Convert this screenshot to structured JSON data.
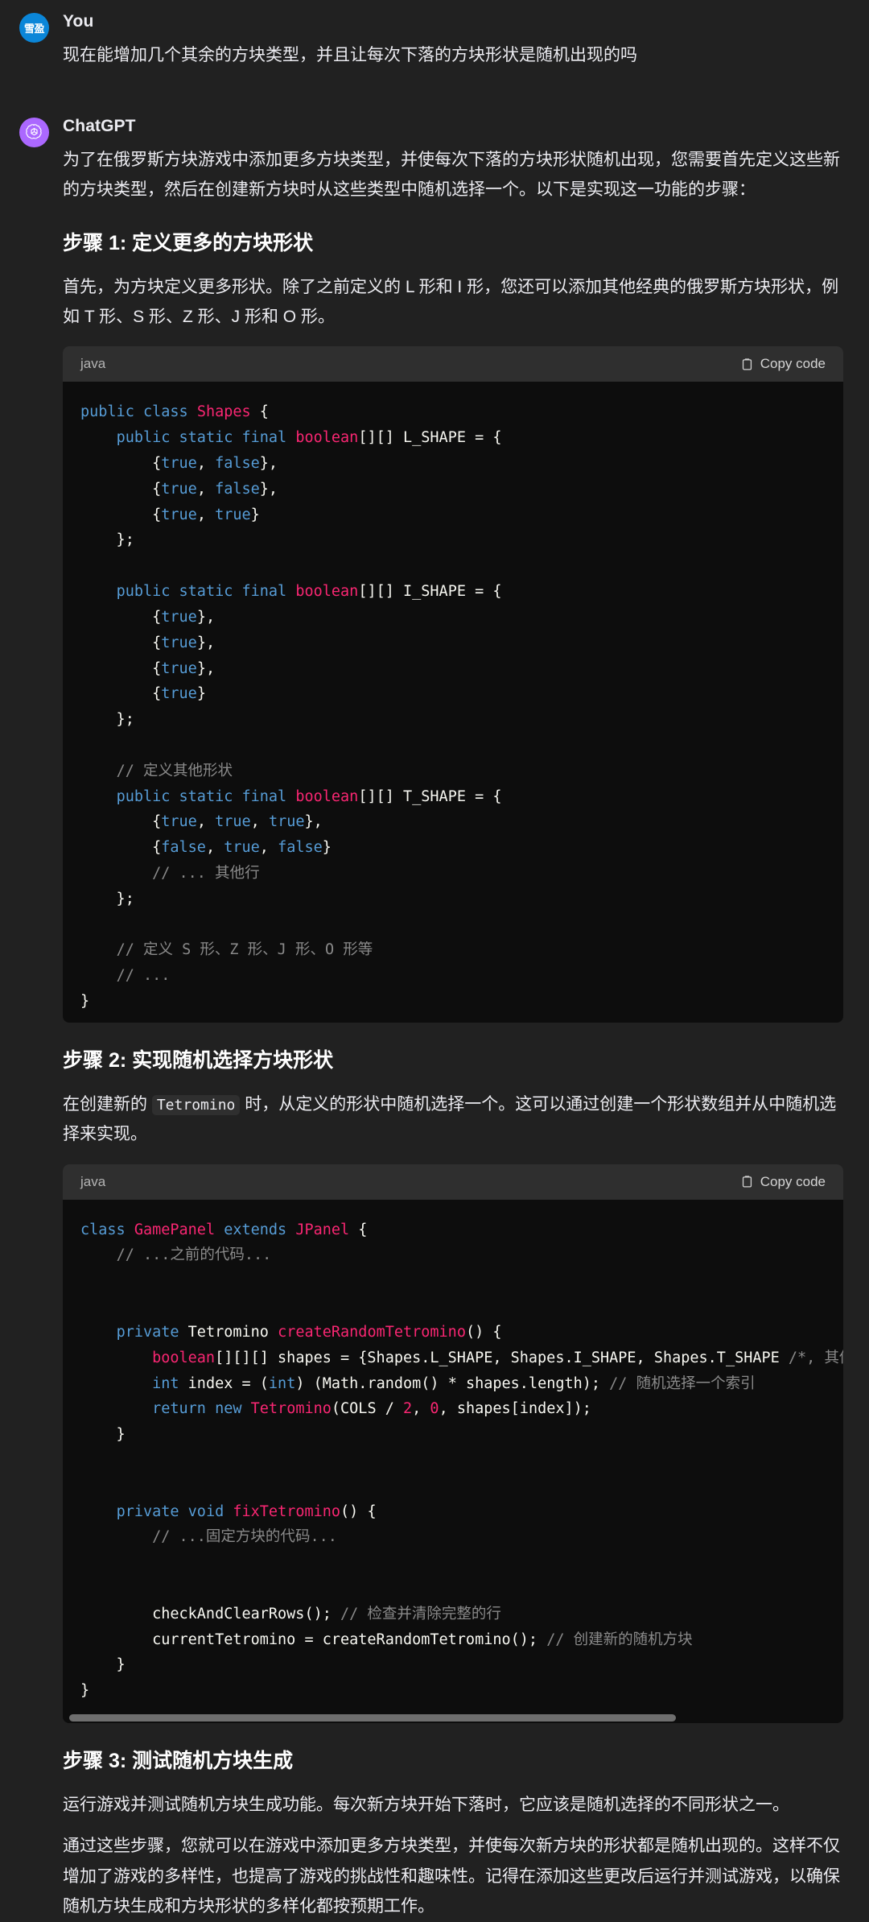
{
  "theme": {
    "page_bg": "#212121",
    "code_bg": "#0d0d0d",
    "code_header_bg": "#2f2f2f",
    "user_avatar_bg": "#0b86d8",
    "assistant_avatar_bg": "#ab68ff",
    "text": "#ececf1",
    "comment": "#8a8a8a",
    "keyword": "#569cd6",
    "type": "#f92672",
    "number": "#f92672"
  },
  "messages": [
    {
      "role": "user",
      "author": "You",
      "avatar_text": "雪盈",
      "avatar_icon": "user-avatar-icon",
      "text": "现在能增加几个其余的方块类型，并且让每次下落的方块形状是随机出现的吗"
    },
    {
      "role": "assistant",
      "author": "ChatGPT",
      "avatar_icon": "openai-logo-icon",
      "intro": "为了在俄罗斯方块游戏中添加更多方块类型，并使每次下落的方块形状随机出现，您需要首先定义这些新的方块类型，然后在创建新方块时从这些类型中随机选择一个。以下是实现这一功能的步骤：",
      "steps": [
        {
          "heading": "步骤 1: 定义更多的方块形状",
          "paragraph": "首先，为方块定义更多形状。除了之前定义的 L 形和 I 形，您还可以添加其他经典的俄罗斯方块形状，例如 T 形、S 形、Z 形、J 形和 O 形。",
          "code": {
            "language": "java",
            "copy_label": "Copy code",
            "copy_icon": "clipboard-icon"
          }
        },
        {
          "heading": "步骤 2: 实现随机选择方块形状",
          "paragraph_pre": "在创建新的 ",
          "paragraph_code": "Tetromino",
          "paragraph_post": " 时，从定义的形状中随机选择一个。这可以通过创建一个形状数组并从中随机选择来实现。",
          "code": {
            "language": "java",
            "copy_label": "Copy code",
            "copy_icon": "clipboard-icon"
          }
        },
        {
          "heading": "步骤 3: 测试随机方块生成",
          "paragraph": "运行游戏并测试随机方块生成功能。每次新方块开始下落时，它应该是随机选择的不同形状之一。"
        }
      ],
      "conclusion": "通过这些步骤，您就可以在游戏中添加更多方块类型，并使每次新方块的形状都是随机出现的。这样不仅增加了游戏的多样性，也提高了游戏的挑战性和趣味性。记得在添加这些更改后运行并测试游戏，以确保随机方块生成和方块形状的多样化都按预期工作。"
    }
  ],
  "code_blocks": [
    {
      "id": "shapes-java",
      "language": "java",
      "lines": [
        [
          [
            "t-kw",
            "public"
          ],
          [
            "t-pl",
            " "
          ],
          [
            "t-kw",
            "class"
          ],
          [
            "t-pl",
            " "
          ],
          [
            "t-cls",
            "Shapes"
          ],
          [
            "t-pl",
            " {"
          ]
        ],
        [
          [
            "t-pl",
            "    "
          ],
          [
            "t-kw",
            "public"
          ],
          [
            "t-pl",
            " "
          ],
          [
            "t-kw",
            "static"
          ],
          [
            "t-pl",
            " "
          ],
          [
            "t-kw",
            "final"
          ],
          [
            "t-pl",
            " "
          ],
          [
            "t-type",
            "boolean"
          ],
          [
            "t-pl",
            "[][] L_SHAPE = {"
          ]
        ],
        [
          [
            "t-pl",
            "        {"
          ],
          [
            "t-bool",
            "true"
          ],
          [
            "t-pl",
            ", "
          ],
          [
            "t-bool",
            "false"
          ],
          [
            "t-pl",
            "},"
          ]
        ],
        [
          [
            "t-pl",
            "        {"
          ],
          [
            "t-bool",
            "true"
          ],
          [
            "t-pl",
            ", "
          ],
          [
            "t-bool",
            "false"
          ],
          [
            "t-pl",
            "},"
          ]
        ],
        [
          [
            "t-pl",
            "        {"
          ],
          [
            "t-bool",
            "true"
          ],
          [
            "t-pl",
            ", "
          ],
          [
            "t-bool",
            "true"
          ],
          [
            "t-pl",
            "}"
          ]
        ],
        [
          [
            "t-pl",
            "    };"
          ]
        ],
        [
          [
            "t-pl",
            ""
          ]
        ],
        [
          [
            "t-pl",
            "    "
          ],
          [
            "t-kw",
            "public"
          ],
          [
            "t-pl",
            " "
          ],
          [
            "t-kw",
            "static"
          ],
          [
            "t-pl",
            " "
          ],
          [
            "t-kw",
            "final"
          ],
          [
            "t-pl",
            " "
          ],
          [
            "t-type",
            "boolean"
          ],
          [
            "t-pl",
            "[][] I_SHAPE = {"
          ]
        ],
        [
          [
            "t-pl",
            "        {"
          ],
          [
            "t-bool",
            "true"
          ],
          [
            "t-pl",
            "},"
          ]
        ],
        [
          [
            "t-pl",
            "        {"
          ],
          [
            "t-bool",
            "true"
          ],
          [
            "t-pl",
            "},"
          ]
        ],
        [
          [
            "t-pl",
            "        {"
          ],
          [
            "t-bool",
            "true"
          ],
          [
            "t-pl",
            "},"
          ]
        ],
        [
          [
            "t-pl",
            "        {"
          ],
          [
            "t-bool",
            "true"
          ],
          [
            "t-pl",
            "}"
          ]
        ],
        [
          [
            "t-pl",
            "    };"
          ]
        ],
        [
          [
            "t-pl",
            ""
          ]
        ],
        [
          [
            "t-pl",
            "    "
          ],
          [
            "t-cmt",
            "// 定义其他形状"
          ]
        ],
        [
          [
            "t-pl",
            "    "
          ],
          [
            "t-kw",
            "public"
          ],
          [
            "t-pl",
            " "
          ],
          [
            "t-kw",
            "static"
          ],
          [
            "t-pl",
            " "
          ],
          [
            "t-kw",
            "final"
          ],
          [
            "t-pl",
            " "
          ],
          [
            "t-type",
            "boolean"
          ],
          [
            "t-pl",
            "[][] T_SHAPE = {"
          ]
        ],
        [
          [
            "t-pl",
            "        {"
          ],
          [
            "t-bool",
            "true"
          ],
          [
            "t-pl",
            ", "
          ],
          [
            "t-bool",
            "true"
          ],
          [
            "t-pl",
            ", "
          ],
          [
            "t-bool",
            "true"
          ],
          [
            "t-pl",
            "},"
          ]
        ],
        [
          [
            "t-pl",
            "        {"
          ],
          [
            "t-bool",
            "false"
          ],
          [
            "t-pl",
            ", "
          ],
          [
            "t-bool",
            "true"
          ],
          [
            "t-pl",
            ", "
          ],
          [
            "t-bool",
            "false"
          ],
          [
            "t-pl",
            "}"
          ]
        ],
        [
          [
            "t-pl",
            "        "
          ],
          [
            "t-cmt",
            "// ... 其他行"
          ]
        ],
        [
          [
            "t-pl",
            "    };"
          ]
        ],
        [
          [
            "t-pl",
            ""
          ]
        ],
        [
          [
            "t-pl",
            "    "
          ],
          [
            "t-cmt",
            "// 定义 S 形、Z 形、J 形、O 形等"
          ]
        ],
        [
          [
            "t-pl",
            "    "
          ],
          [
            "t-cmt",
            "// ..."
          ]
        ],
        [
          [
            "t-pl",
            "}"
          ]
        ]
      ]
    },
    {
      "id": "gamepanel-java",
      "language": "java",
      "lines": [
        [
          [
            "t-kw",
            "class"
          ],
          [
            "t-pl",
            " "
          ],
          [
            "t-cls",
            "GamePanel"
          ],
          [
            "t-pl",
            " "
          ],
          [
            "t-kw",
            "extends"
          ],
          [
            "t-pl",
            " "
          ],
          [
            "t-cls",
            "JPanel"
          ],
          [
            "t-pl",
            " {"
          ]
        ],
        [
          [
            "t-pl",
            "    "
          ],
          [
            "t-cmt",
            "// ...之前的代码..."
          ]
        ],
        [
          [
            "t-pl",
            ""
          ]
        ],
        [
          [
            "t-pl",
            ""
          ]
        ],
        [
          [
            "t-pl",
            "    "
          ],
          [
            "t-kw",
            "private"
          ],
          [
            "t-pl",
            " Tetromino "
          ],
          [
            "t-cls",
            "createRandomTetromino"
          ],
          [
            "t-pl",
            "() {"
          ]
        ],
        [
          [
            "t-pl",
            "        "
          ],
          [
            "t-type",
            "boolean"
          ],
          [
            "t-pl",
            "[][][] shapes = {Shapes.L_SHAPE, Shapes.I_SHAPE, Shapes.T_SHAPE "
          ],
          [
            "t-cmt",
            "/*, 其他形状 */"
          ],
          [
            "t-pl",
            "};"
          ]
        ],
        [
          [
            "t-pl",
            "        "
          ],
          [
            "t-kw",
            "int"
          ],
          [
            "t-pl",
            " index = ("
          ],
          [
            "t-kw",
            "int"
          ],
          [
            "t-pl",
            ") (Math.random() * shapes.length); "
          ],
          [
            "t-cmt",
            "// 随机选择一个索引"
          ]
        ],
        [
          [
            "t-pl",
            "        "
          ],
          [
            "t-kw",
            "return"
          ],
          [
            "t-pl",
            " "
          ],
          [
            "t-kw",
            "new"
          ],
          [
            "t-pl",
            " "
          ],
          [
            "t-cls",
            "Tetromino"
          ],
          [
            "t-pl",
            "(COLS / "
          ],
          [
            "t-num",
            "2"
          ],
          [
            "t-pl",
            ", "
          ],
          [
            "t-num",
            "0"
          ],
          [
            "t-pl",
            ", shapes[index]);"
          ]
        ],
        [
          [
            "t-pl",
            "    }"
          ]
        ],
        [
          [
            "t-pl",
            ""
          ]
        ],
        [
          [
            "t-pl",
            ""
          ]
        ],
        [
          [
            "t-pl",
            "    "
          ],
          [
            "t-kw",
            "private"
          ],
          [
            "t-pl",
            " "
          ],
          [
            "t-kw",
            "void"
          ],
          [
            "t-pl",
            " "
          ],
          [
            "t-cls",
            "fixTetromino"
          ],
          [
            "t-pl",
            "() {"
          ]
        ],
        [
          [
            "t-pl",
            "        "
          ],
          [
            "t-cmt",
            "// ...固定方块的代码..."
          ]
        ],
        [
          [
            "t-pl",
            ""
          ]
        ],
        [
          [
            "t-pl",
            ""
          ]
        ],
        [
          [
            "t-pl",
            "        checkAndClearRows(); "
          ],
          [
            "t-cmt",
            "// 检查并清除完整的行"
          ]
        ],
        [
          [
            "t-pl",
            "        currentTetromino = createRandomTetromino(); "
          ],
          [
            "t-cmt",
            "// 创建新的随机方块"
          ]
        ],
        [
          [
            "t-pl",
            "    }"
          ]
        ],
        [
          [
            "t-pl",
            "}"
          ]
        ]
      ],
      "has_horizontal_scrollbar": true,
      "scroll_thumb_percent": 79
    }
  ]
}
